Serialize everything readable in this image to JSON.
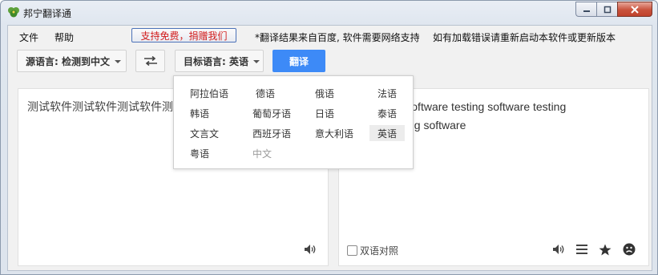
{
  "window": {
    "title": "邦宁翻译通",
    "icon": "clover-app-icon",
    "accent": "#3d8af7"
  },
  "menu": {
    "file": "文件",
    "help": "帮助",
    "support_button": "支持免费，捐赠我们",
    "notice1": "*翻译结果来自百度, 软件需要网络支持",
    "notice2": "如有加载错误请重新启动本软件或更新版本"
  },
  "toolbar": {
    "source_lang": "源语言: 检测到中文",
    "target_lang": "目标语言: 英语",
    "translate": "翻译",
    "swap_icon": "swap-arrows-icon"
  },
  "source": {
    "text": "测试软件测试软件测试软件测试"
  },
  "result": {
    "text": "are testing software testing software testing",
    "text2": "ng software",
    "bilingual_label": "双语对照",
    "bilingual_checked": false
  },
  "dropdown": {
    "languages": [
      {
        "label": "阿拉伯语",
        "disabled": false,
        "selected": false
      },
      {
        "label": "德语",
        "disabled": false,
        "selected": false
      },
      {
        "label": "俄语",
        "disabled": false,
        "selected": false
      },
      {
        "label": "法语",
        "disabled": false,
        "selected": false
      },
      {
        "label": "韩语",
        "disabled": false,
        "selected": false
      },
      {
        "label": "葡萄牙语",
        "disabled": false,
        "selected": false
      },
      {
        "label": "日语",
        "disabled": false,
        "selected": false
      },
      {
        "label": "泰语",
        "disabled": false,
        "selected": false
      },
      {
        "label": "文言文",
        "disabled": false,
        "selected": false
      },
      {
        "label": "西班牙语",
        "disabled": false,
        "selected": false
      },
      {
        "label": "意大利语",
        "disabled": false,
        "selected": false
      },
      {
        "label": "英语",
        "disabled": false,
        "selected": true
      },
      {
        "label": "粤语",
        "disabled": false,
        "selected": false
      },
      {
        "label": "中文",
        "disabled": true,
        "selected": false
      }
    ]
  }
}
